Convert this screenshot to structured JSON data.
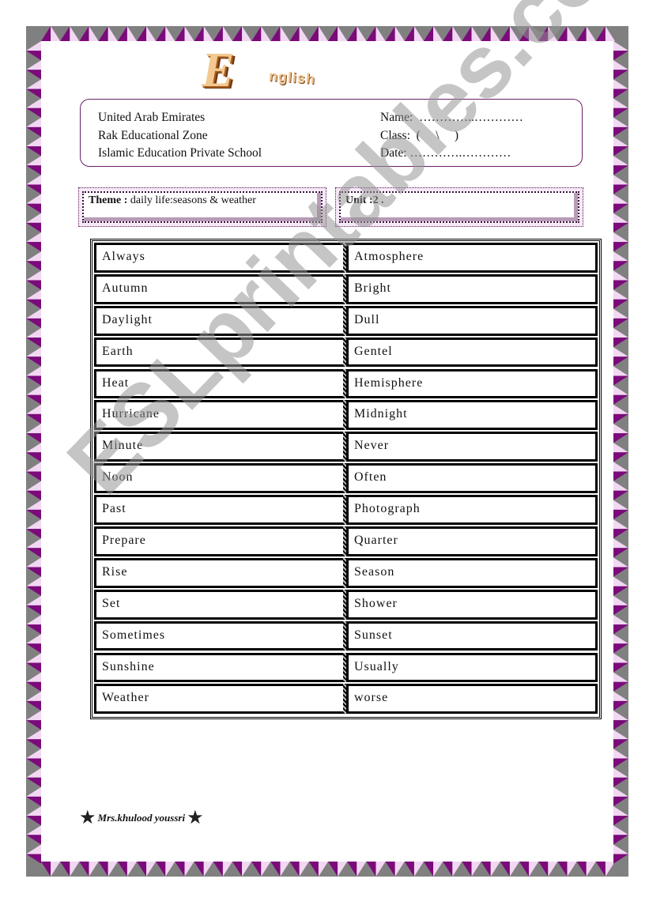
{
  "colors": {
    "frame_gray": "#808080",
    "border_purple": "#7b0a7b",
    "border_pink": "#f2d8f2",
    "box_border": "#6a1f6a"
  },
  "logo": {
    "initial": "E",
    "rest": "nglish"
  },
  "header": {
    "school": [
      "United Arab Emirates",
      "Rak  Educational Zone",
      "Islamic Education Private  School"
    ],
    "student": {
      "name_label": "Name:",
      "name_value": "…………..…………",
      "class_label": "Class:",
      "class_value": "(     \\     )",
      "date_label": "Date:",
      "date_value": "………….…………"
    }
  },
  "theme": {
    "label": "Theme :",
    "value": "daily life:seasons & weather"
  },
  "unit": {
    "label": "Unit :2 .",
    "value": ""
  },
  "vocabulary": [
    [
      "Always",
      "Atmosphere"
    ],
    [
      "Autumn",
      "Bright"
    ],
    [
      "Daylight",
      "Dull"
    ],
    [
      "Earth",
      "Gentel"
    ],
    [
      "Heat",
      "Hemisphere"
    ],
    [
      "Hurricane",
      "Midnight"
    ],
    [
      "Minute",
      "Never"
    ],
    [
      "Noon",
      "Often"
    ],
    [
      "Past",
      "Photograph"
    ],
    [
      "Prepare",
      "Quarter"
    ],
    [
      "Rise",
      "Season"
    ],
    [
      "Set",
      "Shower"
    ],
    [
      "Sometimes",
      "Sunset"
    ],
    [
      "Sunshine",
      "Usually"
    ],
    [
      "Weather",
      "worse"
    ]
  ],
  "watermark": "ESLprintables.com",
  "signature": "Mrs.khulood youssri"
}
